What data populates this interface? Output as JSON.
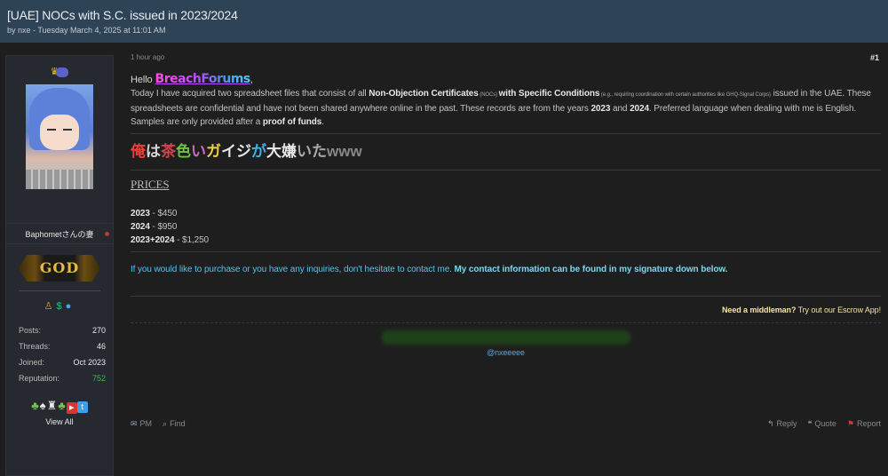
{
  "thread": {
    "title": "[UAE] NOCs with S.C. issued in 2023/2024",
    "byline": "by nxe - Tuesday March 4, 2025 at 11:01 AM"
  },
  "author": {
    "crown_badge": "♛",
    "username": "Baphometさんの妻",
    "rank": "GOD",
    "stats": [
      {
        "label": "Posts:",
        "value": "270"
      },
      {
        "label": "Threads:",
        "value": "46"
      },
      {
        "label": "Joined:",
        "value": "Oct 2023"
      },
      {
        "label": "Reputation:",
        "value": "752"
      }
    ],
    "view_all": "View All"
  },
  "post": {
    "time": "1 hour ago",
    "number": "#1",
    "hello": "Hello",
    "brand": "BreachForums",
    "p1_a": "Today I have acquired two spreadsheet files that consist of all ",
    "p1_b": "Non-Objection Certificates",
    "p1_c": " (NOCs) ",
    "p1_d": "with Specific Conditions",
    "p1_e": " (e.g., requiring coordination with certain authorities like GHQ-Signal Corps)",
    "p1_f": " issued in the UAE. These spreadsheets are confidential and have not been shared anywhere online in the past. These records are from the years ",
    "p1_g": "2023",
    "p1_h": " and ",
    "p1_i": "2024",
    "p1_j": ". Preferred language when dealing with me is English. Samples are only provided after a ",
    "p1_k": "proof of funds",
    "p1_l": ".",
    "jp_chars": [
      "俺",
      "は",
      "茶",
      "色",
      "い",
      "ガ",
      "イジ",
      "が",
      "大嫌",
      "いた",
      "www"
    ],
    "prices_title": "PRICES",
    "prices": [
      {
        "label": "2023",
        "value": " - $450"
      },
      {
        "label": "2024",
        "value": " - $950"
      },
      {
        "label": "2023+2024",
        "value": " - $1,250"
      }
    ],
    "contact_a": "If you would like to purchase or you have any inquiries, don't hesitate to contact me. ",
    "contact_b": "My contact information can be found in my signature down below.",
    "escrow_a": "Need a middleman?",
    "escrow_b": " Try out our Escrow App!",
    "sig_handle": "@nxeeeee"
  },
  "footer": {
    "pm": "PM",
    "find": "Find",
    "reply": "Reply",
    "quote": "Quote",
    "report": "Report"
  },
  "colors": {
    "header_bg": "#2f4356",
    "page_bg": "#1e1e1e",
    "contact_text": "#54c4e8",
    "reputation": "#3fb950"
  }
}
